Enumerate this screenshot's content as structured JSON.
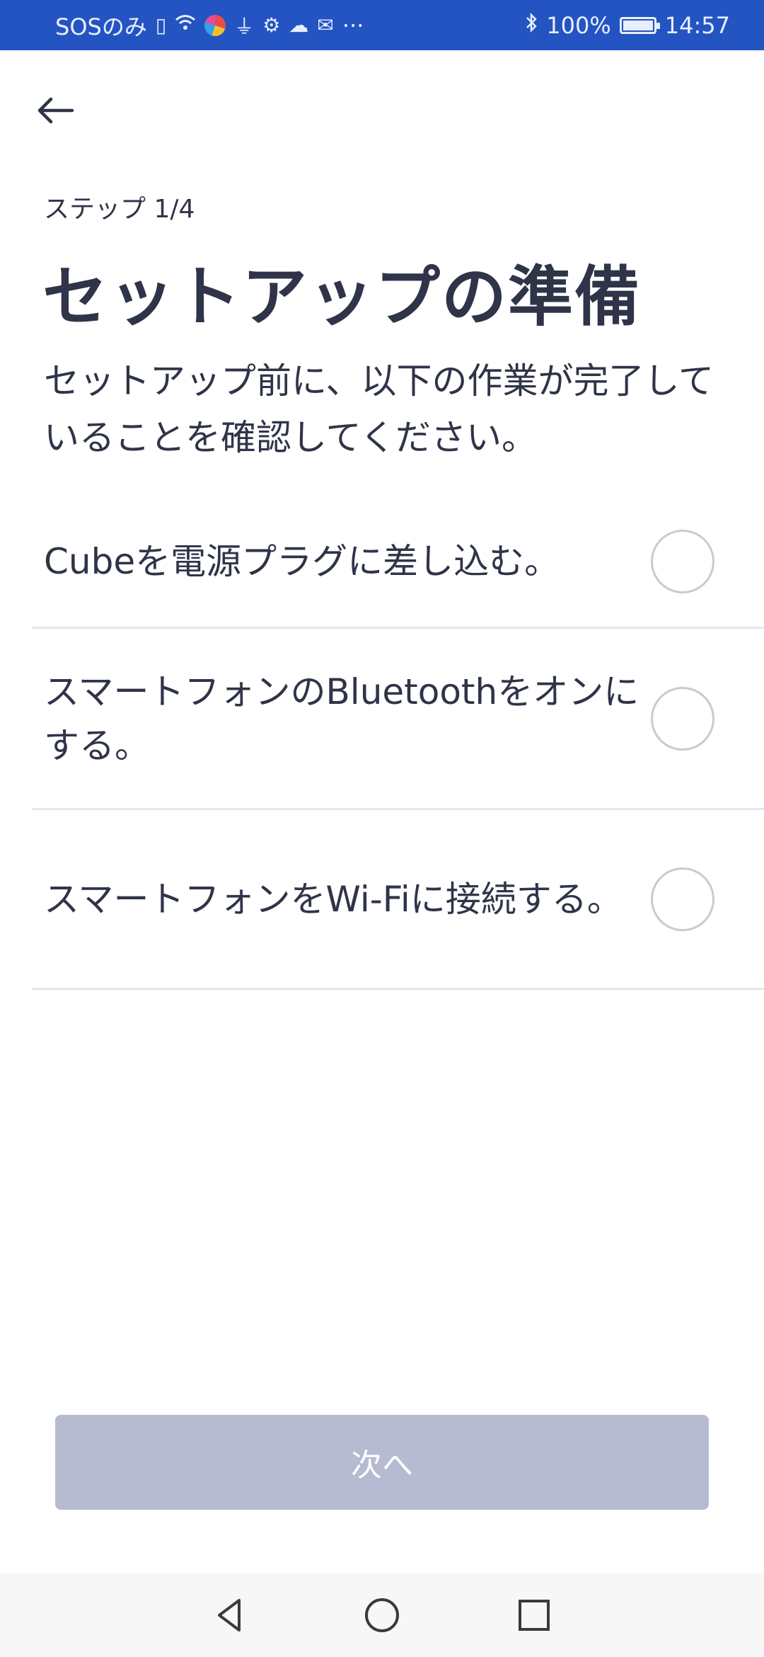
{
  "status_bar": {
    "carrier": "SOSのみ",
    "more": "···",
    "battery": "100%",
    "time": "14:57"
  },
  "header": {
    "step": "ステップ 1/4",
    "title": "セットアップの準備",
    "description": "セットアップ前に、以下の作業が完了していることを確認してください。"
  },
  "checklist": [
    {
      "label": "Cubeを電源プラグに差し込む。",
      "checked": false
    },
    {
      "label": "スマートフォンのBluetoothをオンにする。",
      "checked": false
    },
    {
      "label": "スマートフォンをWi-Fiに接続する。",
      "checked": false
    }
  ],
  "next_button": {
    "label": "次へ",
    "enabled": false
  },
  "colors": {
    "status_bar": "#2354c2",
    "text": "#2f3448",
    "button_disabled": "#b7bbd1",
    "divider": "#e6e7ec"
  }
}
